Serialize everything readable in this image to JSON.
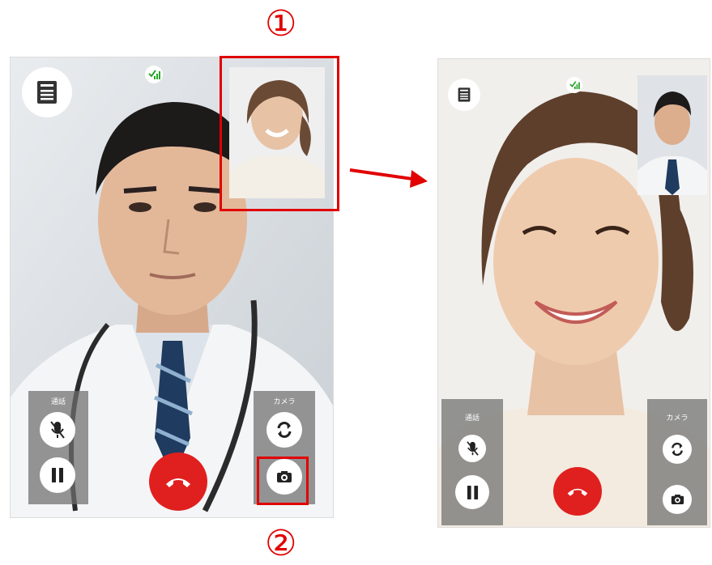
{
  "annotations": {
    "step1": "①",
    "step2": "②"
  },
  "before": {
    "call_label": "通話",
    "camera_label": "カメラ"
  },
  "after": {
    "call_label": "通話",
    "camera_label": "カメラ"
  },
  "icons": [
    "notes-icon",
    "signal-icon",
    "mute-mic-icon",
    "pause-icon",
    "switch-camera-icon",
    "camera-icon",
    "hangup-icon",
    "arrow-icon"
  ],
  "colors": {
    "highlight": "#e10000",
    "hangup": "#e0201f",
    "panel": "#6e6e6e",
    "signal": "#2aa52a"
  }
}
